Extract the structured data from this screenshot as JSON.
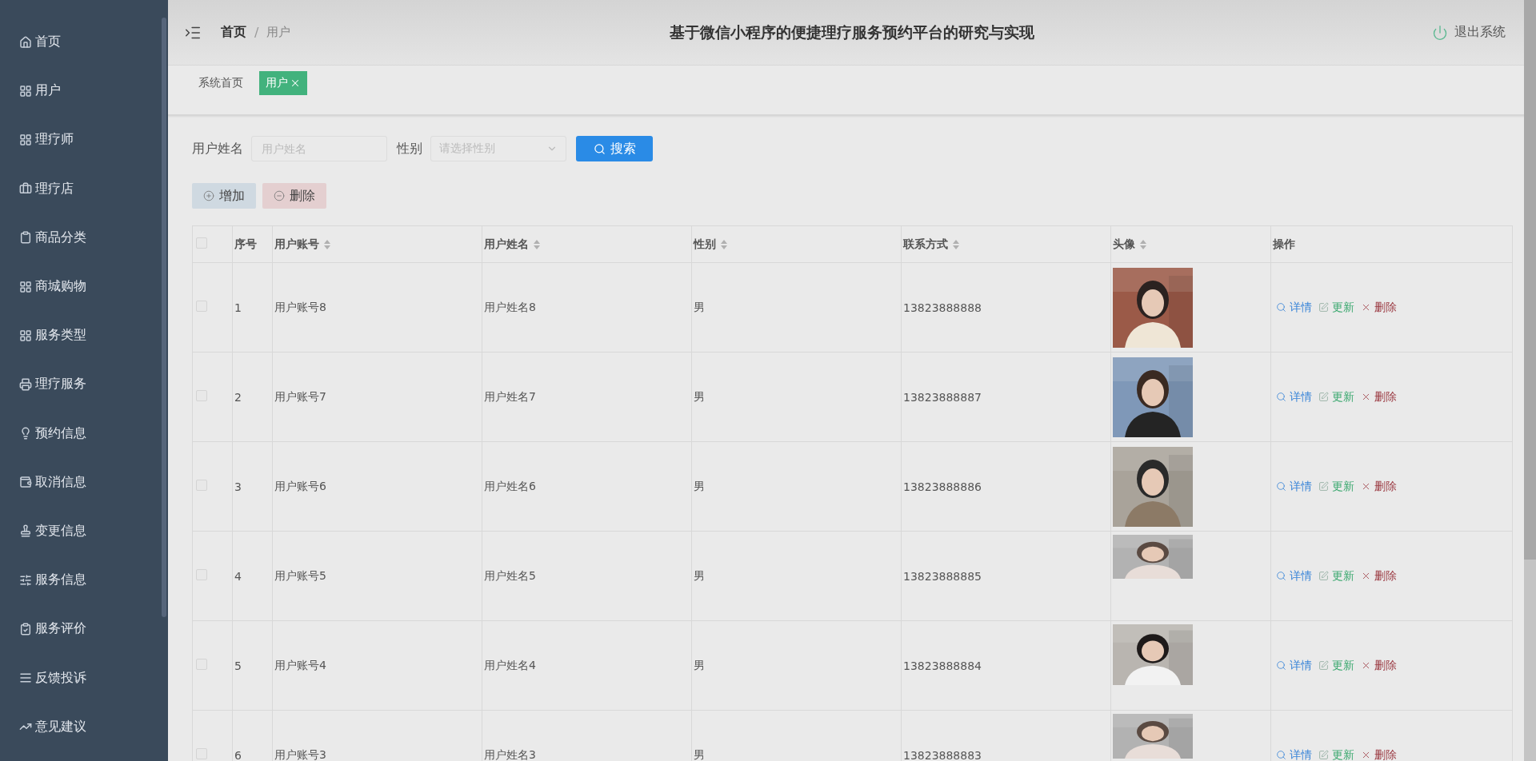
{
  "sidebar": {
    "items": [
      {
        "label": "首页"
      },
      {
        "label": "用户"
      },
      {
        "label": "理疗师"
      },
      {
        "label": "理疗店"
      },
      {
        "label": "商品分类"
      },
      {
        "label": "商城购物"
      },
      {
        "label": "服务类型"
      },
      {
        "label": "理疗服务"
      },
      {
        "label": "预约信息"
      },
      {
        "label": "取消信息"
      },
      {
        "label": "变更信息"
      },
      {
        "label": "服务信息"
      },
      {
        "label": "服务评价"
      },
      {
        "label": "反馈投诉"
      },
      {
        "label": "意见建议"
      }
    ]
  },
  "header": {
    "breadcrumb": [
      "首页",
      "用户"
    ],
    "separator": "/",
    "title": "基于微信小程序的便捷理疗服务预约平台的研究与实现",
    "logout": "退出系统"
  },
  "tags": [
    {
      "label": "系统首页",
      "selected": false
    },
    {
      "label": "用户",
      "selected": true
    }
  ],
  "search": {
    "fields": [
      {
        "label": "用户姓名",
        "kind": "input",
        "placeholder": "用户姓名"
      },
      {
        "label": "性别",
        "kind": "select",
        "placeholder": "请选择性别"
      }
    ],
    "button": "搜索"
  },
  "actions": [
    {
      "label": "增加",
      "kind": "add"
    },
    {
      "label": "删除",
      "kind": "delete"
    }
  ],
  "table": {
    "select_all": {
      "checked": false
    },
    "columns": [
      {
        "label": "序号",
        "sortable": false
      },
      {
        "label": "用户账号",
        "sortable": true
      },
      {
        "label": "用户姓名",
        "sortable": true
      },
      {
        "label": "性别",
        "sortable": true
      },
      {
        "label": "联系方式",
        "sortable": true
      },
      {
        "label": "头像",
        "sortable": true
      },
      {
        "label": "操作",
        "sortable": false
      }
    ],
    "rows": [
      {
        "checked": false,
        "index": "1",
        "account": "用户账号8",
        "name": "用户姓名8",
        "gender": "男",
        "phone": "13823888888",
        "ops": [
          {
            "label": "详情",
            "kind": "view"
          },
          {
            "label": "更新",
            "kind": "edit"
          },
          {
            "label": "删除",
            "kind": "delete"
          }
        ]
      },
      {
        "checked": false,
        "index": "2",
        "account": "用户账号7",
        "name": "用户姓名7",
        "gender": "男",
        "phone": "13823888887",
        "ops": [
          {
            "label": "详情",
            "kind": "view"
          },
          {
            "label": "更新",
            "kind": "edit"
          },
          {
            "label": "删除",
            "kind": "delete"
          }
        ]
      },
      {
        "checked": false,
        "index": "3",
        "account": "用户账号6",
        "name": "用户姓名6",
        "gender": "男",
        "phone": "13823888886",
        "ops": [
          {
            "label": "详情",
            "kind": "view"
          },
          {
            "label": "更新",
            "kind": "edit"
          },
          {
            "label": "删除",
            "kind": "delete"
          }
        ]
      },
      {
        "checked": false,
        "index": "4",
        "account": "用户账号5",
        "name": "用户姓名5",
        "gender": "男",
        "phone": "13823888885",
        "ops": [
          {
            "label": "详情",
            "kind": "view"
          },
          {
            "label": "更新",
            "kind": "edit"
          },
          {
            "label": "删除",
            "kind": "delete"
          }
        ]
      },
      {
        "checked": false,
        "index": "5",
        "account": "用户账号4",
        "name": "用户姓名4",
        "gender": "男",
        "phone": "13823888884",
        "ops": [
          {
            "label": "详情",
            "kind": "view"
          },
          {
            "label": "更新",
            "kind": "edit"
          },
          {
            "label": "删除",
            "kind": "delete"
          }
        ]
      },
      {
        "checked": false,
        "index": "6",
        "account": "用户账号3",
        "name": "用户姓名3",
        "gender": "男",
        "phone": "13823888883",
        "ops": [
          {
            "label": "详情",
            "kind": "view"
          },
          {
            "label": "更新",
            "kind": "edit"
          },
          {
            "label": "删除",
            "kind": "delete"
          }
        ]
      }
    ]
  }
}
